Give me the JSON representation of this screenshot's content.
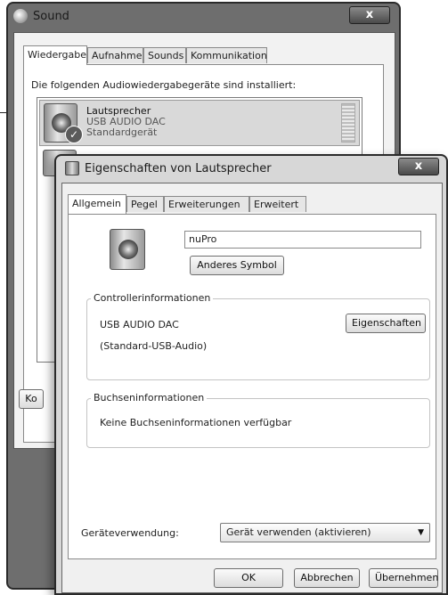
{
  "sound_window": {
    "title": "Sound",
    "close_label": "x",
    "tabs": [
      {
        "label": "Wiedergabe",
        "active": true
      },
      {
        "label": "Aufnahme",
        "active": false
      },
      {
        "label": "Sounds",
        "active": false
      },
      {
        "label": "Kommunikation",
        "active": false
      }
    ],
    "intro_text": "Die folgenden Audiowiedergabegeräte sind installiert:",
    "devices": [
      {
        "name": "Lautsprecher",
        "description": "USB AUDIO   DAC",
        "status": "Standardgerät",
        "icon": "speaker-icon",
        "default_badge": "check-icon"
      }
    ],
    "partial_button_label": "Ko"
  },
  "properties_window": {
    "title": "Eigenschaften von Lautsprecher",
    "close_label": "x",
    "tabs": [
      {
        "label": "Allgemein",
        "active": true
      },
      {
        "label": "Pegel",
        "active": false
      },
      {
        "label": "Erweiterungen",
        "active": false
      },
      {
        "label": "Erweitert",
        "active": false
      }
    ],
    "device_name_value": "nuPro",
    "change_icon_button": "Anderes Symbol",
    "controller_group": {
      "legend": "Controllerinformationen",
      "controller_name": "USB AUDIO   DAC",
      "driver_name": "(Standard-USB-Audio)",
      "properties_button": "Eigenschaften"
    },
    "jack_group": {
      "legend": "Buchseninformationen",
      "text": "Keine Buchseninformationen verfügbar"
    },
    "usage_label": "Geräteverwendung:",
    "usage_value": "Gerät verwenden (aktivieren)",
    "buttons": {
      "ok": "OK",
      "cancel": "Abbrechen",
      "apply": "Übernehmen"
    }
  }
}
